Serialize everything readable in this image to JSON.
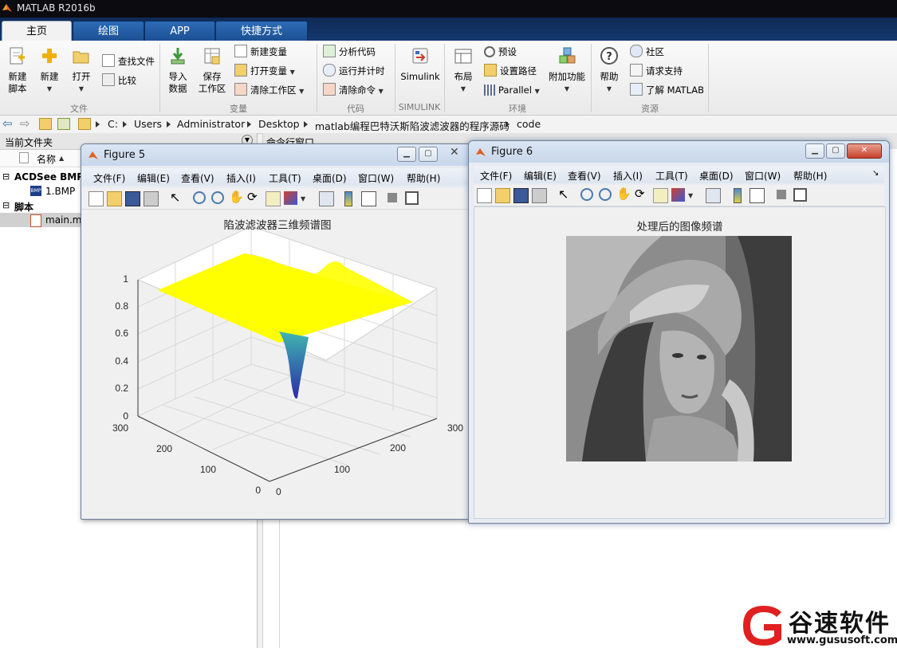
{
  "window": {
    "title": "MATLAB R2016b"
  },
  "tabs": [
    {
      "label": "主页"
    },
    {
      "label": "绘图"
    },
    {
      "label": "APP"
    },
    {
      "label": "快捷方式"
    }
  ],
  "ribbon": {
    "file": {
      "new_script": "新建\n脚本",
      "new": "新建",
      "open": "打开",
      "find_files": "查找文件",
      "compare": "比较",
      "group": "文件"
    },
    "variable": {
      "import": "导入\n数据",
      "save_ws": "保存\n工作区",
      "new_var": "新建变量",
      "open_var": "打开变量",
      "clear_ws": "清除工作区",
      "group": "变量"
    },
    "code": {
      "analyze": "分析代码",
      "run_time": "运行并计时",
      "clear_cmd": "清除命令",
      "group": "代码"
    },
    "simulink": {
      "label": "Simulink",
      "group": "SIMULINK"
    },
    "env": {
      "layout": "布局",
      "prefs": "预设",
      "set_path": "设置路径",
      "parallel": "Parallel",
      "addons": "附加功能",
      "group": "环境"
    },
    "resources": {
      "help": "帮助",
      "community": "社区",
      "request_support": "请求支持",
      "learn": "了解 MATLAB",
      "group": "资源"
    }
  },
  "address": {
    "crumbs": [
      "C:",
      "Users",
      "Administrator",
      "Desktop",
      "matlab编程巴特沃斯陷波滤波器的程序源码",
      "code"
    ]
  },
  "current_folder": {
    "title": "当前文件夹",
    "column": "名称",
    "tree": [
      {
        "label": "ACDSee BMP",
        "bold": true
      },
      {
        "label": "1.BMP",
        "bold": false
      },
      {
        "label": "脚本",
        "bold": true
      },
      {
        "label": "main.m",
        "bold": false
      }
    ]
  },
  "command_window": {
    "title": "命令行窗口"
  },
  "figure5": {
    "title": "Figure 5",
    "menu": [
      "文件(F)",
      "编辑(E)",
      "查看(V)",
      "插入(I)",
      "工具(T)",
      "桌面(D)",
      "窗口(W)",
      "帮助(H)"
    ],
    "plot_title": "陷波滤波器三维频谱图",
    "z_ticks": [
      "0",
      "0.2",
      "0.4",
      "0.6",
      "0.8",
      "1"
    ],
    "y_ticks": [
      "0",
      "100",
      "200",
      "300"
    ],
    "x_ticks": [
      "0",
      "100",
      "200",
      "300"
    ]
  },
  "figure6": {
    "title": "Figure 6",
    "menu": [
      "文件(F)",
      "编辑(E)",
      "查看(V)",
      "插入(I)",
      "工具(T)",
      "桌面(D)",
      "窗口(W)",
      "帮助(H)"
    ],
    "plot_title": "处理后的图像频谱"
  },
  "colors": {
    "surface_top": "#ffff00",
    "notch_top": "#3fb6b0",
    "notch_bottom": "#2a2ca8"
  },
  "watermark": {
    "name": "谷速软件",
    "url": "www.gususoft.com"
  }
}
